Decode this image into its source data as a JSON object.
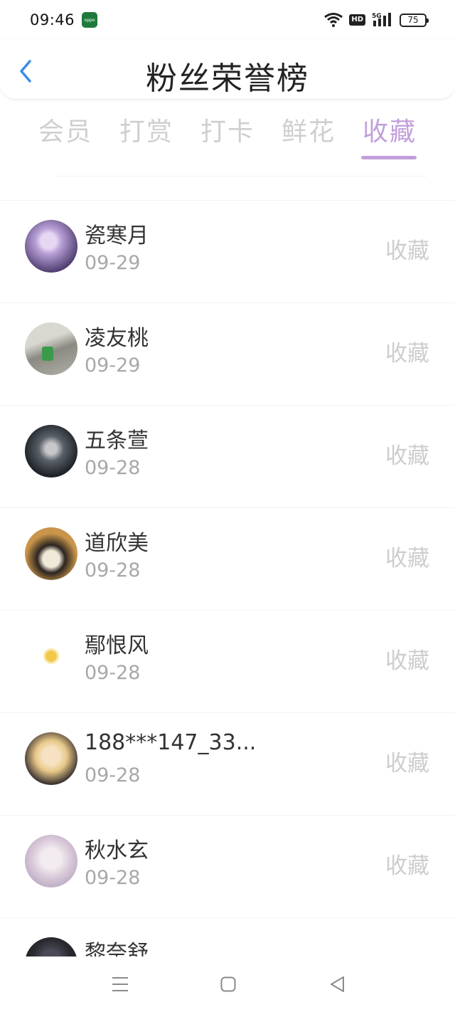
{
  "status_bar": {
    "time": "09:46",
    "app_badge": "oppo",
    "hd": "HD",
    "network": "5G",
    "battery": "75"
  },
  "header": {
    "title": "粉丝荣誉榜",
    "back_icon": "chevron-left-icon",
    "accent_color": "#3a8ee6"
  },
  "tabs": [
    {
      "label": "会员",
      "active": false
    },
    {
      "label": "打赏",
      "active": false
    },
    {
      "label": "打卡",
      "active": false
    },
    {
      "label": "鲜花",
      "active": false
    },
    {
      "label": "收藏",
      "active": true
    }
  ],
  "active_tab_color": "#c29fdc",
  "fans": [
    {
      "name": "瓷寒月",
      "date": "09-29",
      "action": "收藏",
      "avatar_colors": [
        "#b9a0d8",
        "#4a3a6a",
        "#e7d7f2"
      ]
    },
    {
      "name": "凌友桃",
      "date": "09-29",
      "action": "收藏",
      "avatar_colors": [
        "#8a8a82",
        "#d8d8d0",
        "#3a9a4a"
      ]
    },
    {
      "name": "五条萱",
      "date": "09-28",
      "action": "收藏",
      "avatar_colors": [
        "#1e2228",
        "#5a6068",
        "#c8c8cc"
      ]
    },
    {
      "name": "道欣美",
      "date": "09-28",
      "action": "收藏",
      "avatar_colors": [
        "#c8954a",
        "#2a2420",
        "#f2ead8"
      ]
    },
    {
      "name": "鄢恨风",
      "date": "09-28",
      "action": "收藏",
      "avatar_colors": [
        "#ffffff",
        "#f2c94c",
        "#f8e8a8"
      ]
    },
    {
      "name": "188***147_33...",
      "date": "09-28",
      "action": "收藏",
      "avatar_colors": [
        "#3a3230",
        "#e8c888",
        "#f6e2c2"
      ]
    },
    {
      "name": "秋水玄",
      "date": "09-28",
      "action": "收藏",
      "avatar_colors": [
        "#d8c8d8",
        "#f2ecf0",
        "#b8a8c0"
      ]
    },
    {
      "name": "黎奈舒",
      "date": "",
      "action": "",
      "avatar_colors": [
        "#1a1a22",
        "#4a4a58",
        "#2a2a30"
      ]
    }
  ],
  "nav_bar": {
    "menu_icon": "menu-icon",
    "home_icon": "home-square-icon",
    "back_icon": "back-triangle-icon"
  }
}
